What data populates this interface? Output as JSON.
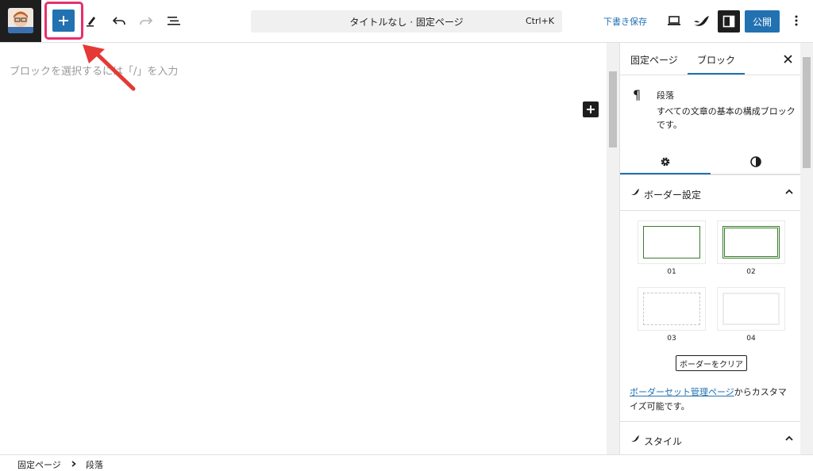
{
  "header": {
    "command_title": "タイトルなし · 固定ページ",
    "command_shortcut": "Ctrl+K",
    "draft_label": "下書き保存",
    "publish_label": "公開"
  },
  "canvas": {
    "placeholder": "ブロックを選択するには「/」を入力"
  },
  "sidebar": {
    "tabs": [
      "固定ページ",
      "ブロック"
    ],
    "active_tab": "ブロック",
    "block": {
      "name": "段落",
      "description": "すべての文章の基本の構成ブロックです。"
    },
    "border_panel": {
      "title": "ボーダー設定",
      "sets": [
        "01",
        "02",
        "03",
        "04"
      ],
      "clear_label": "ボーダーをクリア",
      "manage_link": "ボーダーセット管理ページ",
      "manage_text": "からカスタマイズ可能です。"
    },
    "style_panel": {
      "title": "スタイル"
    }
  },
  "breadcrumb": {
    "items": [
      "固定ページ",
      "段落"
    ]
  },
  "colors": {
    "accent": "#2271b1",
    "highlight": "#e8306a",
    "arrow": "#e53935",
    "border_green": "#3a7d2c"
  }
}
